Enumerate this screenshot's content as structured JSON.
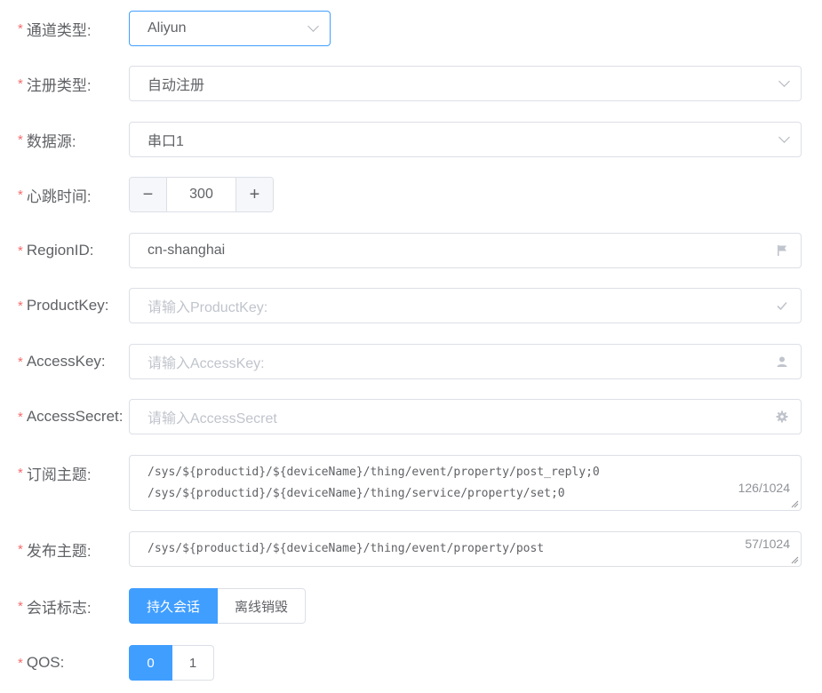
{
  "form": {
    "channel_type": {
      "label": "通道类型:",
      "value": "Aliyun"
    },
    "register_type": {
      "label": "注册类型:",
      "value": "自动注册"
    },
    "data_source": {
      "label": "数据源:",
      "value": "串口1"
    },
    "heartbeat": {
      "label": "心跳时间:",
      "value": "300",
      "decrement": "−",
      "increment": "+"
    },
    "region_id": {
      "label": "RegionID:",
      "value": "cn-shanghai",
      "icon": "flag-icon"
    },
    "product_key": {
      "label": "ProductKey:",
      "placeholder": "请输入ProductKey:",
      "icon": "check-icon"
    },
    "access_key": {
      "label": "AccessKey:",
      "placeholder": "请输入AccessKey:",
      "icon": "user-icon"
    },
    "access_secret": {
      "label": "AccessSecret:",
      "placeholder": "请输入AccessSecret",
      "icon": "gear-icon"
    },
    "subscribe_topic": {
      "label": "订阅主题:",
      "value": "/sys/${productid}/${deviceName}/thing/event/property/post_reply;0\n/sys/${productid}/${deviceName}/thing/service/property/set;0",
      "counter": "126/1024"
    },
    "publish_topic": {
      "label": "发布主题:",
      "value": "/sys/${productid}/${deviceName}/thing/event/property/post",
      "counter": "57/1024"
    },
    "session_flag": {
      "label": "会话标志:",
      "options": [
        "持久会话",
        "离线销毁"
      ],
      "selected": "持久会话"
    },
    "qos": {
      "label": "QOS:",
      "options": [
        "0",
        "1"
      ],
      "selected": "0"
    }
  },
  "colors": {
    "primary": "#409eff",
    "required": "#f56c6c",
    "border": "#dcdfe6",
    "placeholder": "#c0c4cc"
  }
}
